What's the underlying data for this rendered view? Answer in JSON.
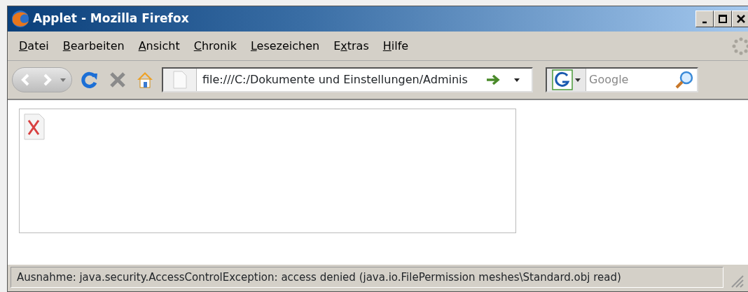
{
  "window": {
    "title": "Applet - Mozilla Firefox",
    "controls": [
      {
        "kind": "minimize"
      },
      {
        "kind": "maximize"
      },
      {
        "kind": "close"
      }
    ]
  },
  "menu": [
    {
      "access_key": "D",
      "after": "atei"
    },
    {
      "access_key": "B",
      "after": "earbeiten"
    },
    {
      "access_key": "A",
      "after": "nsicht"
    },
    {
      "access_key": "C",
      "after": "hronik"
    },
    {
      "access_key": "L",
      "after": "esezeichen"
    },
    {
      "before": "E",
      "access_key": "x",
      "after": "tras"
    },
    {
      "access_key": "H",
      "after": "ilfe"
    }
  ],
  "toolbar": {
    "address": "file:///C:/Dokumente und Einstellungen/Adminis",
    "search": {
      "placeholder": "Google"
    }
  },
  "status_bar": "Ausnahme: java.security.AccessControlException: access denied (java.io.FilePermission meshes\\Standard.obj read)"
}
